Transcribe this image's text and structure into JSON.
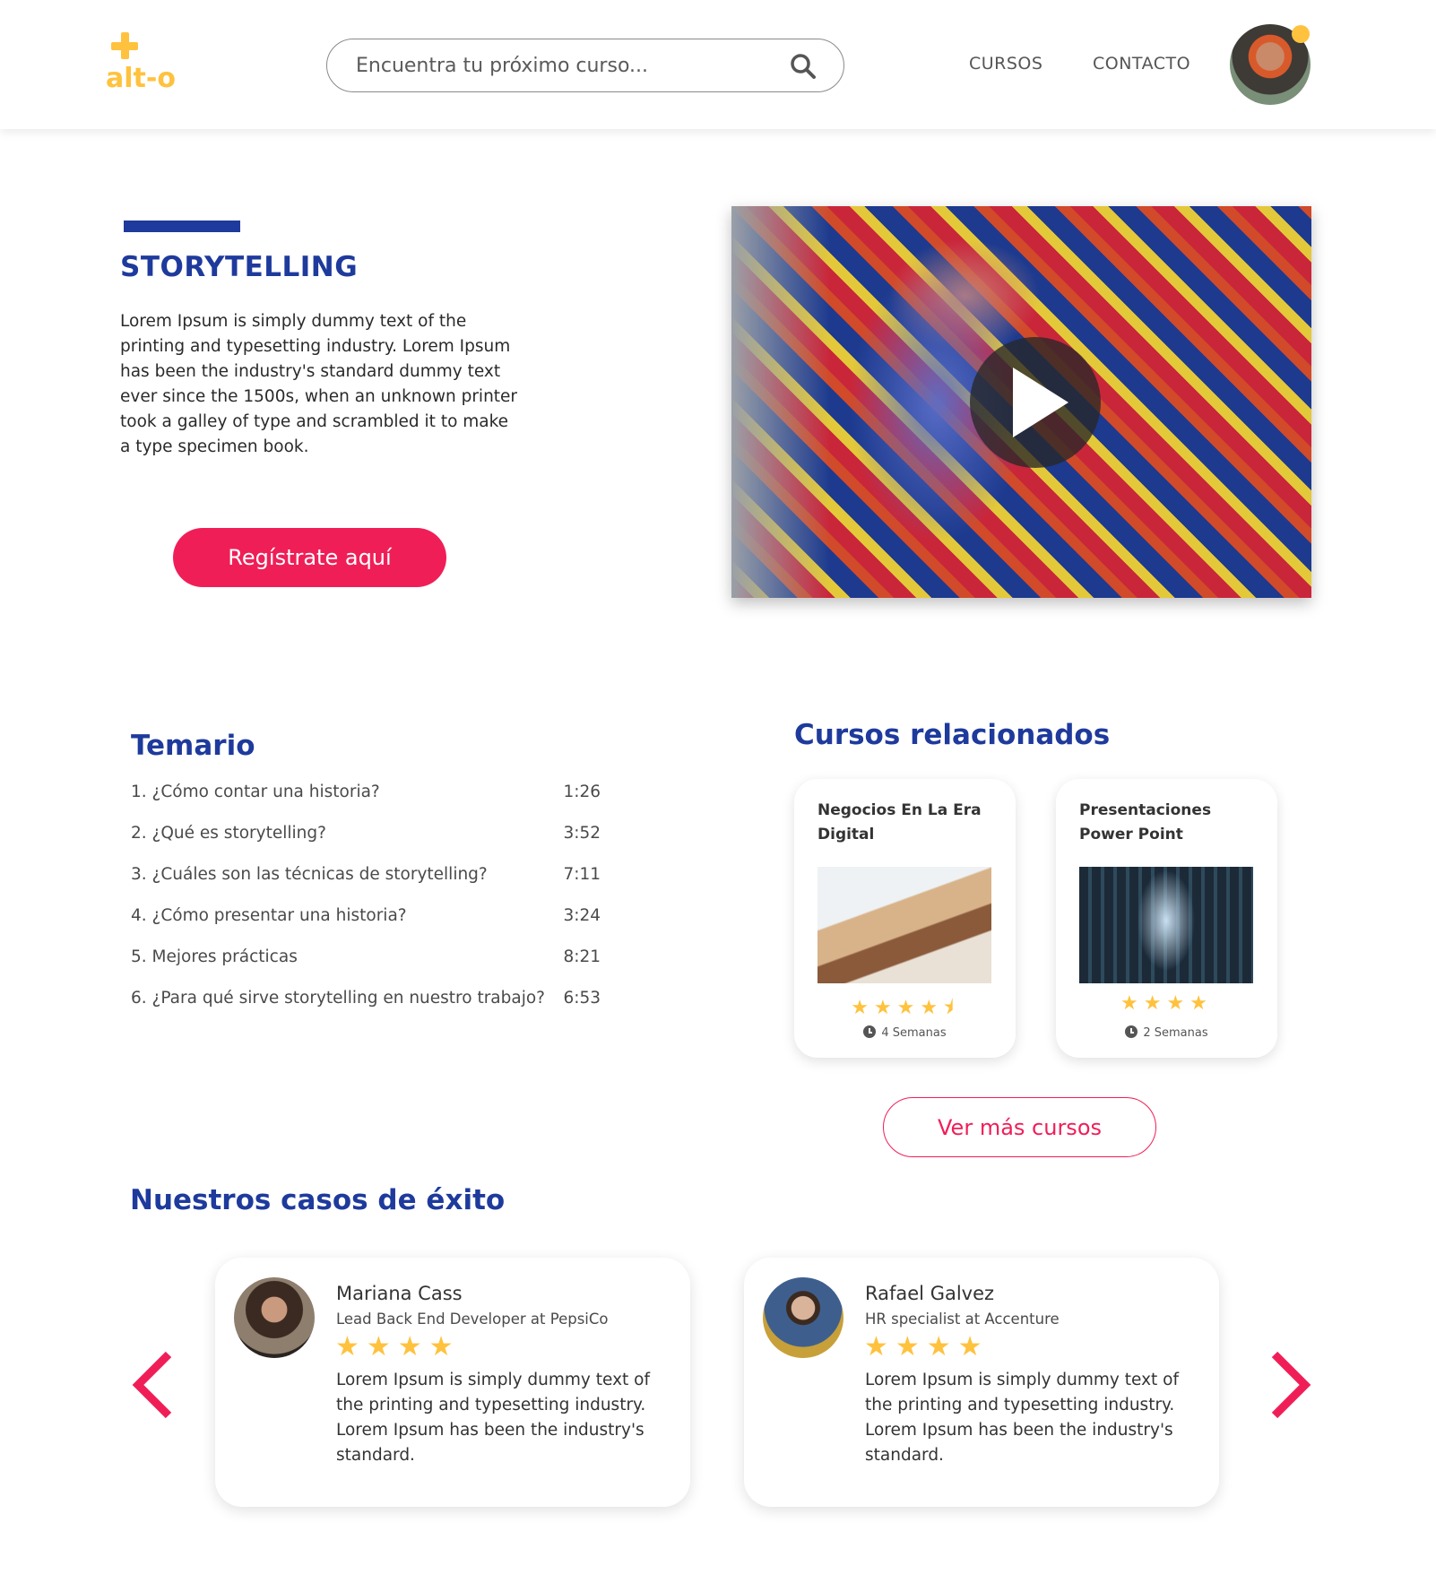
{
  "header": {
    "logo_text": "alt-o",
    "search_placeholder": "Encuentra tu próximo curso...",
    "nav": [
      "CURSOS",
      "CONTACTO"
    ]
  },
  "hero": {
    "title": "STORYTELLING",
    "description": "Lorem Ipsum is simply dummy text of the printing and typesetting industry. Lorem Ipsum has been the industry's standard dummy text ever since the 1500s, when an unknown printer took a galley of type and scrambled it to make a type specimen book.",
    "cta_label": "Regístrate aquí"
  },
  "syllabus": {
    "title": "Temario",
    "items": [
      {
        "title": "1. ¿Cómo contar una historia?",
        "duration": "1:26"
      },
      {
        "title": "2. ¿Qué es storytelling?",
        "duration": "3:52"
      },
      {
        "title": "3. ¿Cuáles son las técnicas de storytelling?",
        "duration": "7:11"
      },
      {
        "title": "4. ¿Cómo presentar una historia?",
        "duration": "3:24"
      },
      {
        "title": "5. Mejores prácticas",
        "duration": "8:21"
      },
      {
        "title": "6. ¿Para qué sirve storytelling en nuestro trabajo?",
        "duration": "6:53"
      }
    ]
  },
  "related": {
    "title": "Cursos relacionados",
    "courses": [
      {
        "name": "Negocios En La Era Digital",
        "stars": "★★★★⯨",
        "rating": 4.5,
        "duration": "4 Semanas"
      },
      {
        "name": "Presentaciones Power Point",
        "stars": "★★★★",
        "rating": 4,
        "duration": "2 Semanas"
      }
    ],
    "more_label": "Ver más cursos"
  },
  "testimonials": {
    "title": "Nuestros casos de éxito",
    "items": [
      {
        "name": "Mariana Cass",
        "role": "Lead Back End Developer at PepsiCo",
        "stars": "★★★★",
        "rating": 4,
        "quote": "Lorem Ipsum is simply dummy text of the printing and typesetting industry. Lorem Ipsum has been the industry's standard."
      },
      {
        "name": "Rafael Galvez",
        "role": "HR specialist at Accenture",
        "stars": "★★★★",
        "rating": 4,
        "quote": "Lorem Ipsum is simply dummy text of the printing and typesetting industry. Lorem Ipsum has been the industry's standard."
      }
    ]
  },
  "colors": {
    "brand_yellow": "#ffc23e",
    "primary_blue": "#1e3a9c",
    "accent_pink": "#f01e57"
  }
}
